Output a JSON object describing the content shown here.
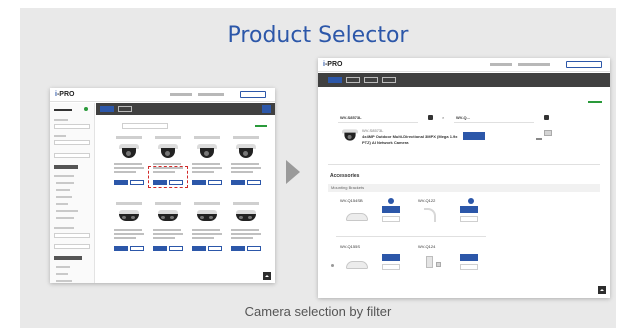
{
  "title": "Product Selector",
  "caption": "Camera selection by filter",
  "colors": {
    "brand_blue": "#2c57a9",
    "panel_bg": "#e9e9e9",
    "arrow": "#9a9a9a"
  },
  "icons": {
    "arrow": "chevron-right-icon"
  },
  "left_screenshot": {
    "logo": "i-PRO",
    "tabs": [
      "Main",
      "Sub"
    ],
    "product_cards": 8,
    "highlighted_card_index": 1
  },
  "right_screenshot": {
    "logo": "i-PRO",
    "tabs": [
      "Main",
      "Sub",
      "Misc",
      "Option"
    ],
    "selected_product": {
      "model": "WV-S8573L",
      "description_line1": "WV-S8573L",
      "description_line2": "4x4MP Outdoor Multi-Directional 3MPX (Mega 1.9x",
      "description_line3": "PTZ) AI Network Camera",
      "secondary": "WV-Q..."
    },
    "accessories_heading": "Accessories",
    "accessory_subheading": "Mounting Brackets",
    "accessories": [
      {
        "model": "WV-Q154SB"
      },
      {
        "model": "WV-Q122"
      },
      {
        "model": "WV-Q155S"
      },
      {
        "model": "WV-Q124"
      }
    ]
  }
}
